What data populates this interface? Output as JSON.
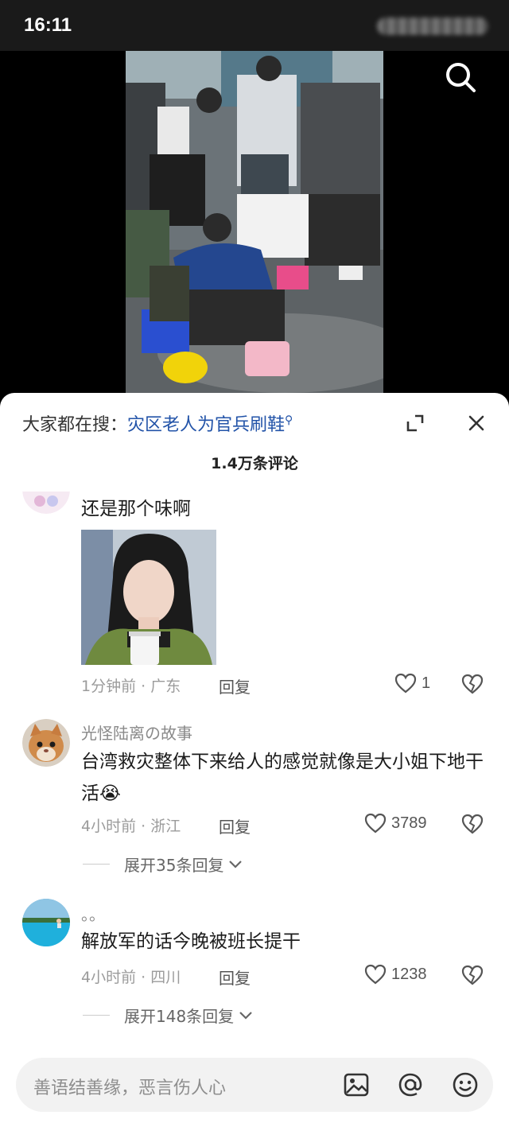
{
  "status_bar": {
    "time": "16:11"
  },
  "comment_sheet": {
    "hot_search_prefix": "大家都在搜：",
    "hot_search_link": "灾区老人为官兵刷鞋",
    "count_title": "1.4万条评论",
    "comments": [
      {
        "username": "",
        "text": "还是那个味啊",
        "meta": "1分钟前 · 广东",
        "reply_label": "回复",
        "likes": "1",
        "has_image": true
      },
      {
        "username": "光怪陆离の故事",
        "text": "台湾救灾整体下来给人的感觉就像是大小姐下地干活😭",
        "meta": "4小时前 · 浙江",
        "reply_label": "回复",
        "likes": "3789",
        "expand_label": "展开35条回复"
      },
      {
        "username": "。。",
        "text": "解放军的话今晚被班长提干",
        "meta": "4小时前 · 四川",
        "reply_label": "回复",
        "likes": "1238",
        "expand_label": "展开148条回复"
      }
    ]
  },
  "input_bar": {
    "placeholder": "善语结善缘，恶言伤人心",
    "icons": [
      "image-icon",
      "mention-icon",
      "emoji-icon"
    ]
  },
  "colors": {
    "link": "#2253a8",
    "sheet_bg": "#ffffff",
    "input_bg": "#f2f2f2"
  }
}
